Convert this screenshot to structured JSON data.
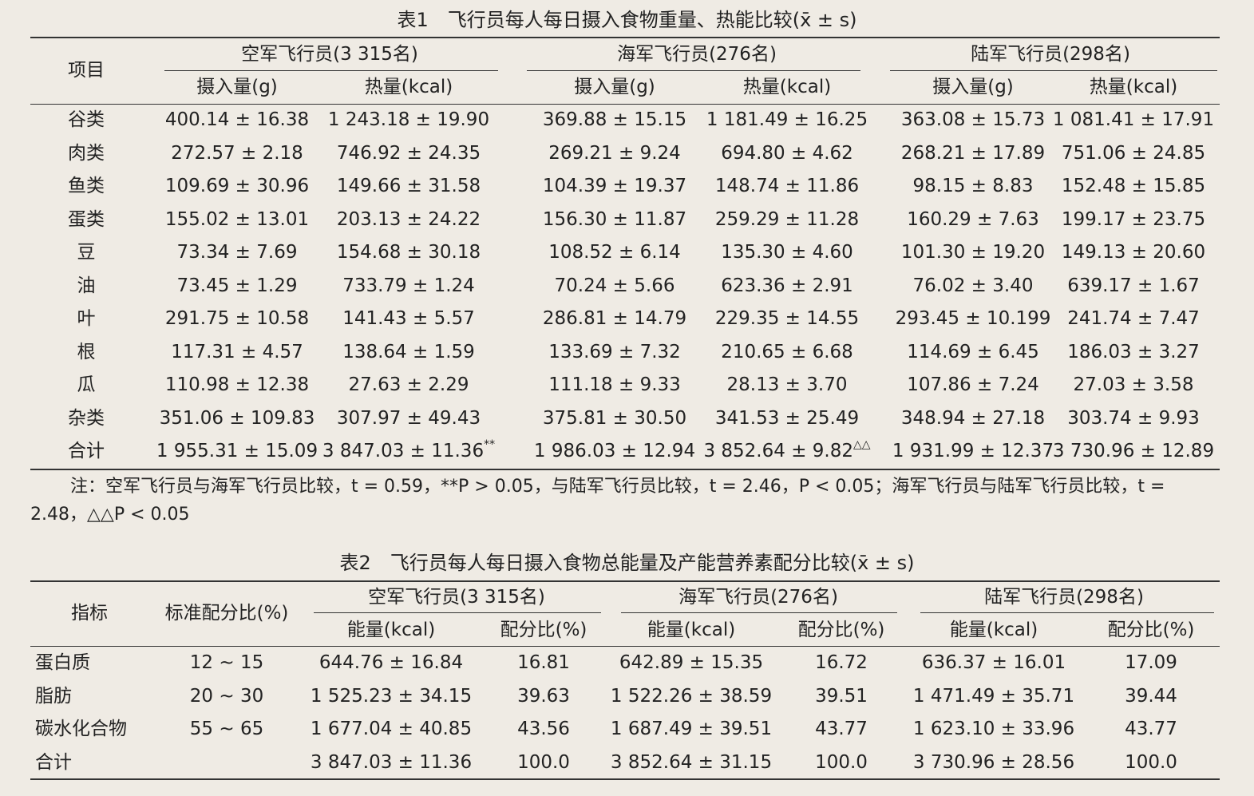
{
  "table1": {
    "caption": "表1　飞行员每人每日摄入食物重量、热能比较(x̄ ± s)",
    "header": {
      "item": "项目",
      "groups": [
        "空军飞行员(3 315名)",
        "海军飞行员(276名)",
        "陆军飞行员(298名)"
      ],
      "subcols": [
        "摄入量(g)",
        "热量(kcal)",
        "摄入量(g)",
        "热量(kcal)",
        "摄入量(g)",
        "热量(kcal)"
      ]
    },
    "rows": [
      {
        "item": "谷类",
        "cells": [
          "400.14 ± 16.38",
          "1 243.18 ± 19.90",
          "369.88 ± 15.15",
          "1 181.49 ± 16.25",
          "363.08 ± 15.73",
          "1 081.41 ± 17.91"
        ]
      },
      {
        "item": "肉类",
        "cells": [
          "272.57 ± 2.18",
          "746.92 ± 24.35",
          "269.21 ± 9.24",
          "694.80 ± 4.62",
          "268.21 ± 17.89",
          "751.06 ± 24.85"
        ]
      },
      {
        "item": "鱼类",
        "cells": [
          "109.69 ± 30.96",
          "149.66 ± 31.58",
          "104.39 ± 19.37",
          "148.74 ± 11.86",
          "98.15 ± 8.83",
          "152.48 ± 15.85"
        ]
      },
      {
        "item": "蛋类",
        "cells": [
          "155.02 ± 13.01",
          "203.13 ± 24.22",
          "156.30 ± 11.87",
          "259.29 ± 11.28",
          "160.29 ± 7.63",
          "199.17 ± 23.75"
        ]
      },
      {
        "item": "豆",
        "cells": [
          "73.34 ± 7.69",
          "154.68 ± 30.18",
          "108.52 ± 6.14",
          "135.30 ± 4.60",
          "101.30 ± 19.20",
          "149.13 ± 20.60"
        ]
      },
      {
        "item": "油",
        "cells": [
          "73.45 ± 1.29",
          "733.79 ± 1.24",
          "70.24 ± 5.66",
          "623.36 ± 2.91",
          "76.02 ± 3.40",
          "639.17 ± 1.67"
        ]
      },
      {
        "item": "叶",
        "cells": [
          "291.75 ± 10.58",
          "141.43 ± 5.57",
          "286.81 ± 14.79",
          "229.35 ± 14.55",
          "293.45 ± 10.199",
          "241.74 ± 7.47"
        ]
      },
      {
        "item": "根",
        "cells": [
          "117.31 ± 4.57",
          "138.64 ± 1.59",
          "133.69 ± 7.32",
          "210.65 ± 6.68",
          "114.69 ± 6.45",
          "186.03 ± 3.27"
        ]
      },
      {
        "item": "瓜",
        "cells": [
          "110.98 ± 12.38",
          "27.63 ± 2.29",
          "111.18 ± 9.33",
          "28.13 ± 3.70",
          "107.86 ± 7.24",
          "27.03 ± 3.58"
        ]
      },
      {
        "item": "杂类",
        "cells": [
          "351.06 ± 109.83",
          "307.97 ± 49.43",
          "375.81 ± 30.50",
          "341.53 ± 25.49",
          "348.94 ± 27.18",
          "303.74 ± 9.93"
        ]
      },
      {
        "item": "合计",
        "cells": [
          "1 955.31 ± 15.09",
          "3 847.03 ± 11.36**",
          "1 986.03 ± 12.94",
          "3 852.64 ± 9.82△△",
          "1 931.99 ± 12.37",
          "3 730.96 ± 12.89"
        ]
      }
    ],
    "note": "注：空军飞行员与海军飞行员比较，t = 0.59，**P > 0.05，与陆军飞行员比较，t = 2.46，P < 0.05；海军飞行员与陆军飞行员比较，t = 2.48，△△P < 0.05"
  },
  "table2": {
    "caption": "表2　飞行员每人每日摄入食物总能量及产能营养素配分比较(x̄ ± s)",
    "header": {
      "indicator": "指标",
      "standard": "标准配分比(%)",
      "groups": [
        "空军飞行员(3 315名)",
        "海军飞行员(276名)",
        "陆军飞行员(298名)"
      ],
      "subcols": [
        "能量(kcal)",
        "配分比(%)",
        "能量(kcal)",
        "配分比(%)",
        "能量(kcal)",
        "配分比(%)"
      ]
    },
    "rows": [
      {
        "item": "蛋白质",
        "standard": "12 ~ 15",
        "cells": [
          "644.76 ± 16.84",
          "16.81",
          "642.89 ± 15.35",
          "16.72",
          "636.37 ± 16.01",
          "17.09"
        ]
      },
      {
        "item": "脂肪",
        "standard": "20 ~ 30",
        "cells": [
          "1 525.23 ± 34.15",
          "39.63",
          "1 522.26 ± 38.59",
          "39.51",
          "1 471.49 ± 35.71",
          "39.44"
        ]
      },
      {
        "item": "碳水化合物",
        "standard": "55 ~ 65",
        "cells": [
          "1 677.04 ± 40.85",
          "43.56",
          "1 687.49 ± 39.51",
          "43.77",
          "1 623.10 ± 33.96",
          "43.77"
        ]
      },
      {
        "item": "合计",
        "standard": "",
        "cells": [
          "3 847.03 ± 11.36",
          "100.0",
          "3 852.64 ± 31.15",
          "100.0",
          "3 730.96 ± 28.56",
          "100.0"
        ]
      }
    ]
  }
}
